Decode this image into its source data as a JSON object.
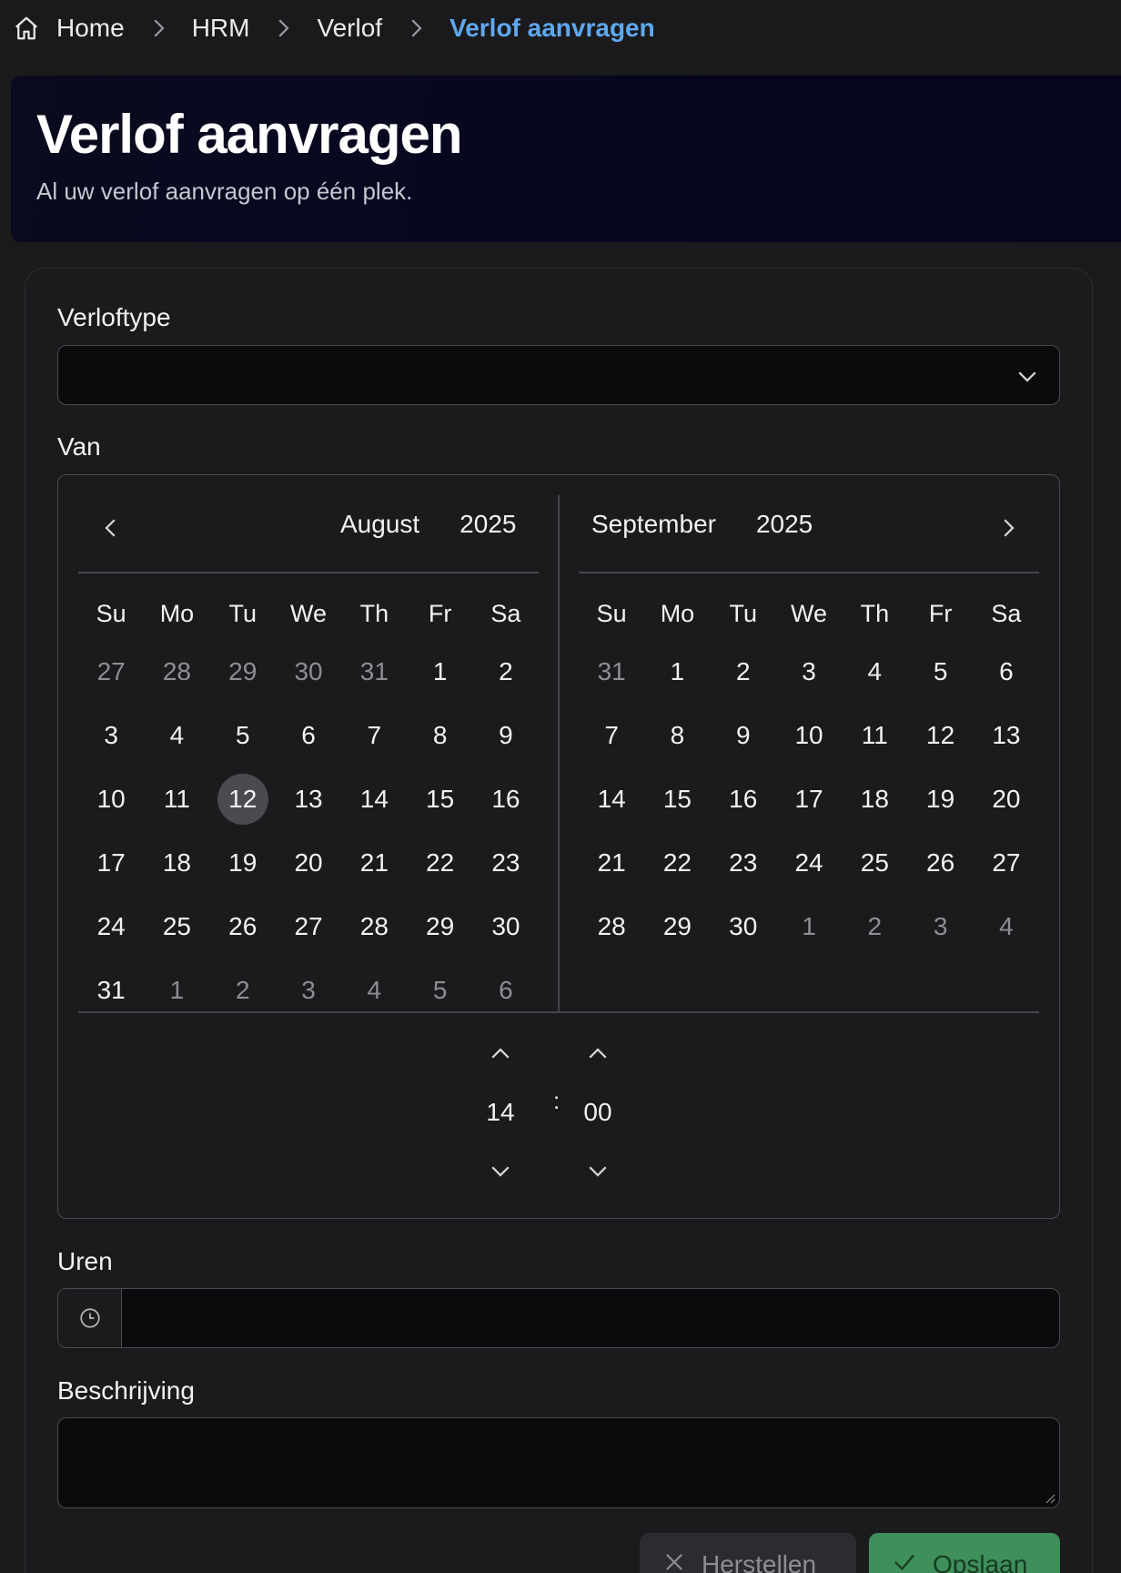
{
  "breadcrumb": {
    "items": [
      "Home",
      "HRM",
      "Verlof"
    ],
    "current": "Verlof aanvragen"
  },
  "hero": {
    "title": "Verlof aanvragen",
    "subtitle": "Al uw verlof aanvragen op één plek."
  },
  "form": {
    "leave_type_label": "Verloftype",
    "leave_type_value": "",
    "from_label": "Van",
    "hours_label": "Uren",
    "hours_value": "",
    "description_label": "Beschrijving",
    "description_value": "",
    "reset_label": "Herstellen",
    "save_label": "Opslaan"
  },
  "calendar": {
    "weekdays": [
      "Su",
      "Mo",
      "Tu",
      "We",
      "Th",
      "Fr",
      "Sa"
    ],
    "left": {
      "month": "August",
      "year": "2025",
      "weeks": [
        [
          [
            "27",
            1
          ],
          [
            "28",
            1
          ],
          [
            "29",
            1
          ],
          [
            "30",
            1
          ],
          [
            "31",
            1
          ],
          [
            "1",
            0
          ],
          [
            "2",
            0
          ]
        ],
        [
          [
            "3",
            0
          ],
          [
            "4",
            0
          ],
          [
            "5",
            0
          ],
          [
            "6",
            0
          ],
          [
            "7",
            0
          ],
          [
            "8",
            0
          ],
          [
            "9",
            0
          ]
        ],
        [
          [
            "10",
            0
          ],
          [
            "11",
            0
          ],
          [
            "12",
            0
          ],
          [
            "13",
            0
          ],
          [
            "14",
            0
          ],
          [
            "15",
            0
          ],
          [
            "16",
            0
          ]
        ],
        [
          [
            "17",
            0
          ],
          [
            "18",
            0
          ],
          [
            "19",
            0
          ],
          [
            "20",
            0
          ],
          [
            "21",
            0
          ],
          [
            "22",
            0
          ],
          [
            "23",
            0
          ]
        ],
        [
          [
            "24",
            0
          ],
          [
            "25",
            0
          ],
          [
            "26",
            0
          ],
          [
            "27",
            0
          ],
          [
            "28",
            0
          ],
          [
            "29",
            0
          ],
          [
            "30",
            0
          ]
        ],
        [
          [
            "31",
            0
          ],
          [
            "1",
            1
          ],
          [
            "2",
            1
          ],
          [
            "3",
            1
          ],
          [
            "4",
            1
          ],
          [
            "5",
            1
          ],
          [
            "6",
            1
          ]
        ]
      ],
      "selected_day": "12"
    },
    "right": {
      "month": "September",
      "year": "2025",
      "weeks": [
        [
          [
            "31",
            1
          ],
          [
            "1",
            0
          ],
          [
            "2",
            0
          ],
          [
            "3",
            0
          ],
          [
            "4",
            0
          ],
          [
            "5",
            0
          ],
          [
            "6",
            0
          ]
        ],
        [
          [
            "7",
            0
          ],
          [
            "8",
            0
          ],
          [
            "9",
            0
          ],
          [
            "10",
            0
          ],
          [
            "11",
            0
          ],
          [
            "12",
            0
          ],
          [
            "13",
            0
          ]
        ],
        [
          [
            "14",
            0
          ],
          [
            "15",
            0
          ],
          [
            "16",
            0
          ],
          [
            "17",
            0
          ],
          [
            "18",
            0
          ],
          [
            "19",
            0
          ],
          [
            "20",
            0
          ]
        ],
        [
          [
            "21",
            0
          ],
          [
            "22",
            0
          ],
          [
            "23",
            0
          ],
          [
            "24",
            0
          ],
          [
            "25",
            0
          ],
          [
            "26",
            0
          ],
          [
            "27",
            0
          ]
        ],
        [
          [
            "28",
            0
          ],
          [
            "29",
            0
          ],
          [
            "30",
            0
          ],
          [
            "1",
            1
          ],
          [
            "2",
            1
          ],
          [
            "3",
            1
          ],
          [
            "4",
            1
          ]
        ]
      ]
    },
    "time": {
      "hours": "14",
      "minutes": "00",
      "separator": ":"
    }
  },
  "colors": {
    "accent": "#5fa8f0",
    "save_button": "#3f8f5a",
    "selected_day": "#4a4a50"
  },
  "icons": [
    "home-icon",
    "chevron-right-icon",
    "chevron-down-icon",
    "chevron-left-icon",
    "chevron-up-icon",
    "clock-icon",
    "close-icon",
    "check-icon"
  ]
}
